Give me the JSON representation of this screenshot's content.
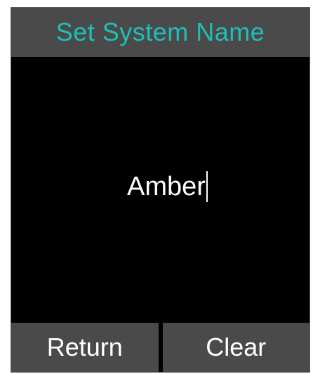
{
  "header": {
    "title": "Set System Name"
  },
  "entry": {
    "value": "Amber"
  },
  "softkeys": {
    "left_label": "Return",
    "right_label": "Clear"
  },
  "colors": {
    "title_text": "#1fbfb8",
    "bar_background": "#4a4a4a",
    "screen_background": "#000000",
    "text": "#ffffff"
  }
}
